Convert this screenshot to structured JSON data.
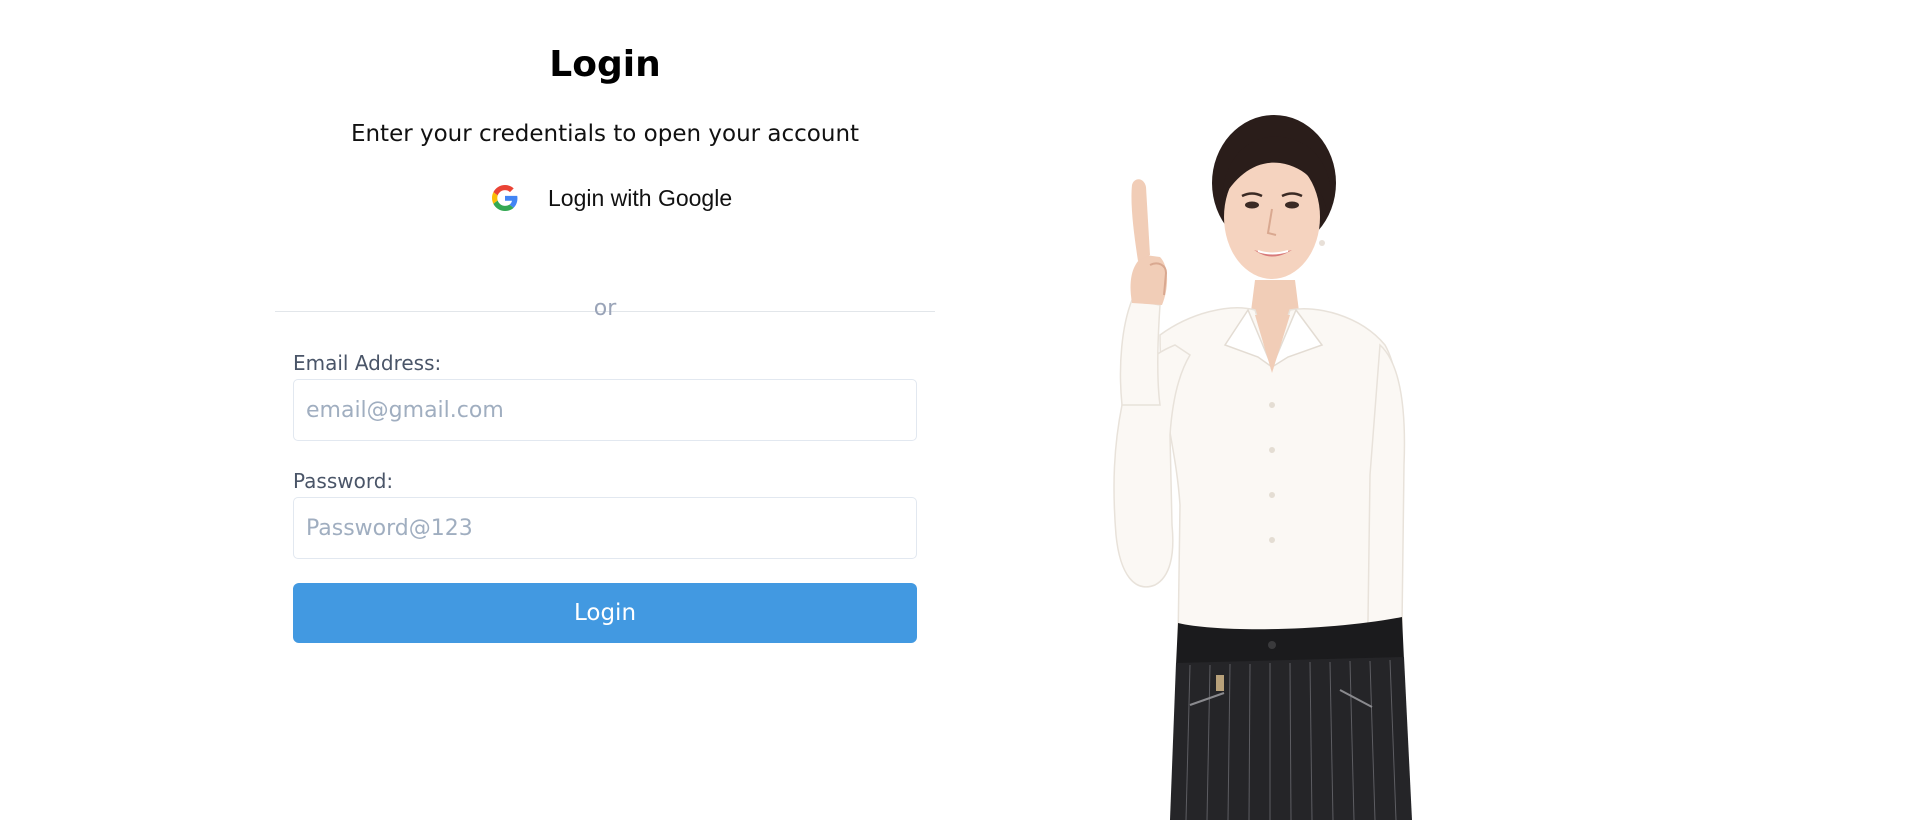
{
  "login_form": {
    "title": "Login",
    "subtitle": "Enter your credentials to open your account",
    "google_button_label": "Login with Google",
    "google_icon": "google-icon",
    "divider_text": "or",
    "email": {
      "label": "Email Address:",
      "value": "",
      "placeholder": "email@gmail.com"
    },
    "password": {
      "label": "Password:",
      "value": "",
      "placeholder": "Password@123"
    },
    "submit_label": "Login"
  },
  "hero_image": {
    "icon": "woman-pointing-up-illustration"
  },
  "colors": {
    "primary": "#4299e1",
    "divider_text": "#9aa4b8",
    "input_border": "#e2e8f0",
    "placeholder": "#a0aec0"
  }
}
